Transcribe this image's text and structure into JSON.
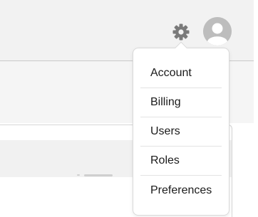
{
  "header": {
    "settings_icon": "gear-icon",
    "avatar_icon": "user-avatar-icon"
  },
  "menu": {
    "items": [
      {
        "label": "Account"
      },
      {
        "label": "Billing"
      },
      {
        "label": "Users"
      },
      {
        "label": "Roles"
      },
      {
        "label": "Preferences"
      }
    ]
  },
  "colors": {
    "header_bg": "#f2f2f2",
    "icon_gray": "#7a7a7a",
    "avatar_gray": "#bdbdbd",
    "menu_border": "#d9d9d9",
    "text": "#1a1a1a"
  }
}
